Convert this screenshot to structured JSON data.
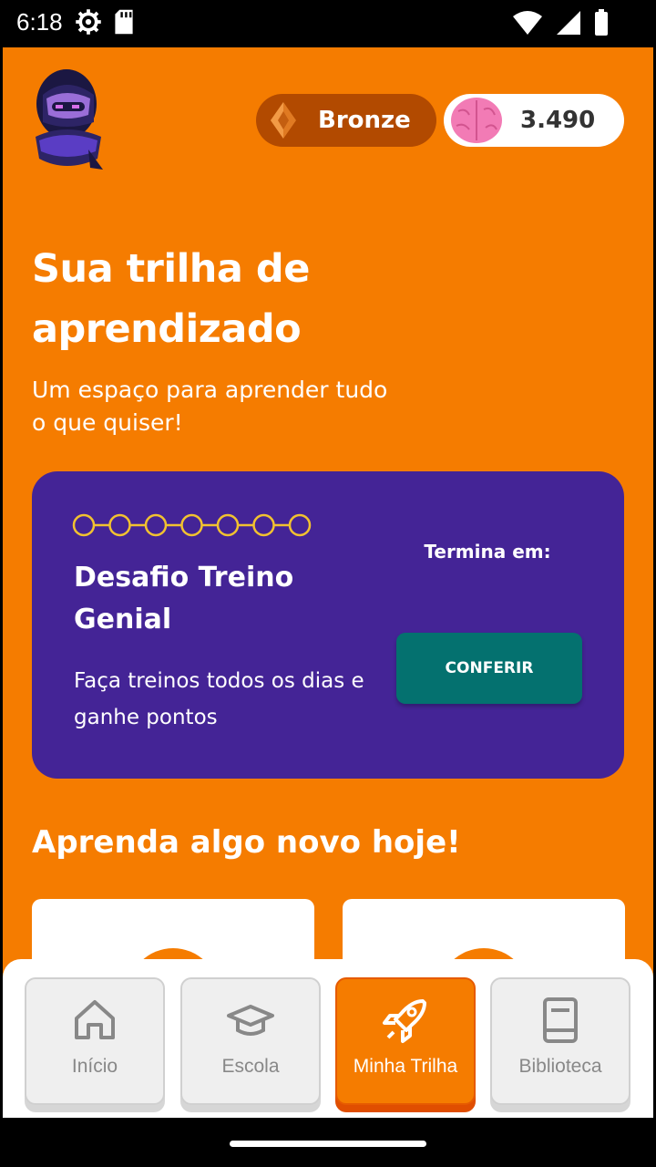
{
  "status_bar": {
    "time": "6:18",
    "icons": [
      "settings-icon",
      "sd-card-icon",
      "wifi-icon",
      "signal-icon",
      "battery-icon"
    ]
  },
  "header": {
    "avatar_icon": "ninja-avatar-icon",
    "league": {
      "icon": "bronze-gem-icon",
      "label": "Bronze"
    },
    "points": {
      "icon": "brain-icon",
      "value": "3.490"
    }
  },
  "hero": {
    "title": "Sua trilha de aprendizado",
    "subtitle": "Um espaço para aprender tudo o que quiser!"
  },
  "challenge": {
    "steps_total": 7,
    "steps_completed": 0,
    "title": "Desafio Treino Genial",
    "description": "Faça treinos todos os dias e ganhe pontos",
    "ends_label": "Termina em:",
    "button_label": "CONFERIR"
  },
  "learn_section": {
    "title": "Aprenda algo novo hoje!"
  },
  "bottom_nav": {
    "items": [
      {
        "label": "Início",
        "icon": "home-icon",
        "active": false
      },
      {
        "label": "Escola",
        "icon": "graduation-cap-icon",
        "active": false
      },
      {
        "label": "Minha Trilha",
        "icon": "rocket-icon",
        "active": true
      },
      {
        "label": "Biblioteca",
        "icon": "book-icon",
        "active": false
      }
    ]
  },
  "colors": {
    "primary_orange": "#F57C00",
    "challenge_purple": "#442496",
    "button_teal": "#04716F",
    "progress_yellow": "#F2C230",
    "league_bronze": "#B24A00"
  }
}
